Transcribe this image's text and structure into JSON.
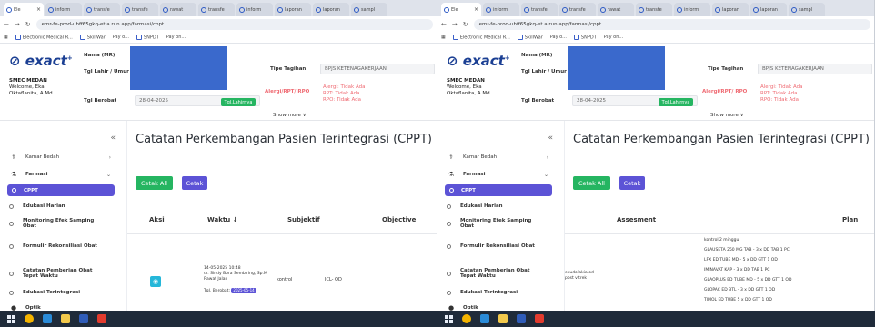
{
  "browser": {
    "tabs": [
      "Ele",
      "inform",
      "transfe",
      "transfe",
      "rawat",
      "transfe",
      "inform",
      "laporan",
      "laporan",
      "sampl",
      "langsu"
    ],
    "url": "emr-fe-prod-uhff65gkq-et.a.run.app/farmasi/cppt",
    "bookmarks": [
      "Electronic Medical R...",
      "SkillWar",
      "Pay o...",
      "SNPDT",
      "Pay on..."
    ]
  },
  "header": {
    "logo_text": "exact",
    "unit": "SMEC MEDAN",
    "welcome": "Welcome, Eka",
    "user": "Oktaflanita, A.Md",
    "labels": {
      "nama": "Nama (MR)",
      "tgl_lahir": "Tgl Lahir / Umur",
      "tgl_berobat": "Tgl Berobat",
      "tipe_tagihan": "Tipe Tagihan",
      "alergi": "Alergi/RPT/ RPO"
    },
    "tgl_berobat_value": "28-04-2025",
    "tgl_lahirnya_button": "Tgl.Lahirnya",
    "tipe_tagihan_value": "BPJS KETENAGAKERJAAN",
    "alergi_lines": [
      "Alergi: Tidak Ada",
      "RPT: Tidak Ada",
      "RPO: Tidak Ada"
    ],
    "show_more": "Show more ∨"
  },
  "sidebar": {
    "collapse": "«",
    "items": [
      {
        "label": "Kamar Bedah",
        "icon": "hospital-bed-icon"
      },
      {
        "label": "Farmasi",
        "icon": "pharmacy-icon"
      },
      {
        "label": "CPPT",
        "active": true
      },
      {
        "label": "Edukasi Harian"
      },
      {
        "label": "Monitoring Efek Samping Obat"
      },
      {
        "label": "Formulir Rekonsiliasi Obat"
      },
      {
        "label": "Catatan Pemberian Obat Tepat Waktu"
      },
      {
        "label": "Edukasi Terintegrasi"
      },
      {
        "label": "Optik"
      }
    ]
  },
  "main": {
    "title": "Catatan Perkembangan Pasien Terintegrasi (CPPT)",
    "cetak_all": "Cetak All",
    "cetak": "Cetak",
    "columns_left": [
      "Aksi",
      "Waktu ↓",
      "Subjektif",
      "Objective"
    ],
    "columns_right": [
      "Assesment",
      "Plan"
    ],
    "row_left": {
      "waktu": [
        "14-05-2025 10:48",
        "dr. Sindy Bora Sembiring, Sp.M",
        "Rawat Jalan"
      ],
      "tgl_berobat_label": "Tgl. Berobat:",
      "tgl_berobat_badge": "2025-05-14",
      "subjektif": "kontrol",
      "objective": "ICL- OD"
    },
    "row_right": {
      "assesment": [
        "exudofakia od",
        "post vitrek"
      ],
      "plan": [
        "kontrol 2 minggu",
        "GLAUSETA 250 MG TAB - 3 x DD TAB 1 PC",
        "LFX ED TUBE MD - 5 x DD GTT 1 OD",
        "IMINAVAT KAP - 3 x DD TAB 1 PC",
        "GLAOPLUS ED TUBE MD - 5 x DD GTT 1 OD",
        "GLOPAC ED BTL - 3 x DD GTT 1 OD",
        "TIMOL ED TUBE 5 x DD GTT 1 OD"
      ]
    }
  },
  "colors": {
    "accent": "#5c53d6",
    "green": "#25b561",
    "cyan": "#25b7d9",
    "redaction": "#3a69cc",
    "alert": "#ef6b73",
    "taskbar": "#1f2b3a"
  }
}
